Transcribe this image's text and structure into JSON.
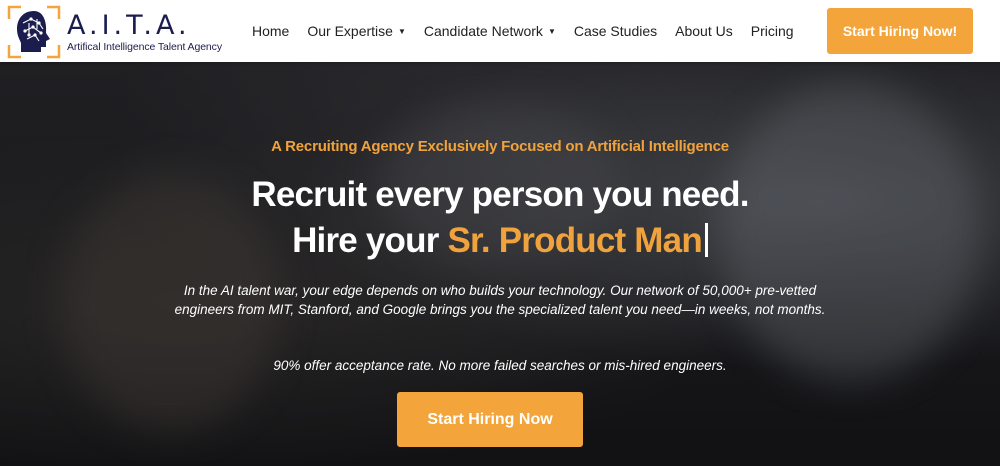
{
  "logo": {
    "title": "A.I.T.A.",
    "subtitle": "Artifical Intelligence Talent Agency",
    "icon": "ai-head-icon"
  },
  "nav": {
    "items": [
      {
        "label": "Home",
        "has_dropdown": false
      },
      {
        "label": "Our Expertise",
        "has_dropdown": true
      },
      {
        "label": "Candidate Network",
        "has_dropdown": true
      },
      {
        "label": "Case Studies",
        "has_dropdown": false
      },
      {
        "label": "About Us",
        "has_dropdown": false
      },
      {
        "label": "Pricing",
        "has_dropdown": false
      }
    ],
    "dropdown_glyph": "▼"
  },
  "header_cta": {
    "label": "Start Hiring Now!"
  },
  "hero": {
    "eyebrow": "A Recruiting Agency Exclusively Focused on Artificial Intelligence",
    "headline_line1": "Recruit every person you need.",
    "headline_line2_prefix": "Hire your ",
    "headline_line2_typed": "Sr. Product Man",
    "description": "In the AI talent war, your edge depends on who builds your technology. Our network of 50,000+ pre-vetted engineers from MIT, Stanford, and Google brings you the specialized talent you need—in weeks, not months.",
    "stat_line": "90% offer acceptance rate. No more failed searches or mis-hired engineers.",
    "cta_label": "Start Hiring Now"
  },
  "colors": {
    "accent": "#f3a43a",
    "brand_navy": "#1c1d4f",
    "header_bg": "#ffffff",
    "hero_text": "#ffffff"
  }
}
